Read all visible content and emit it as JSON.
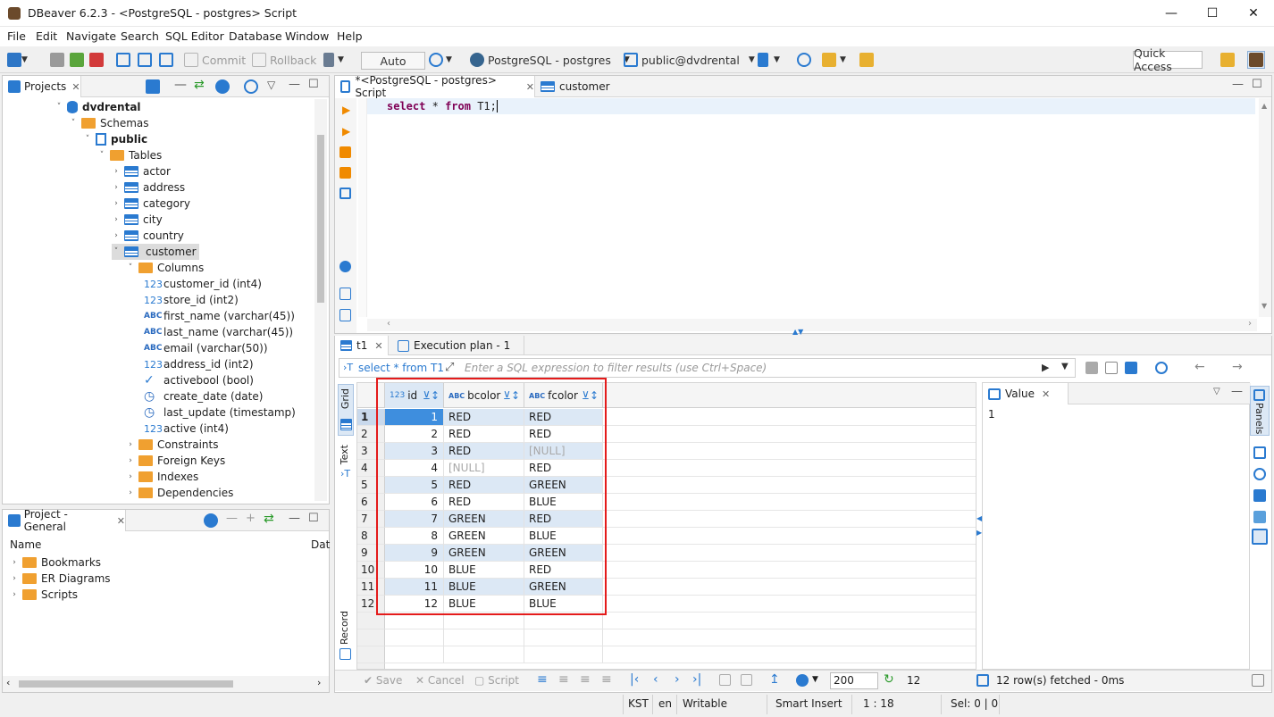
{
  "window": {
    "title": "DBeaver 6.2.3 - <PostgreSQL - postgres> Script"
  },
  "menu": [
    "File",
    "Edit",
    "Navigate",
    "Search",
    "SQL Editor",
    "Database",
    "Window",
    "Help"
  ],
  "toolbar": {
    "commit": "Commit",
    "rollback": "Rollback",
    "mode": "Auto",
    "connection": "PostgreSQL - postgres",
    "schema": "public@dvdrental",
    "quick_access": "Quick Access"
  },
  "projects": {
    "tab": "Projects",
    "tree": [
      {
        "label": "dvdrental",
        "level": 0,
        "icon": "database-icon",
        "bold": true,
        "tw": "v"
      },
      {
        "label": "Schemas",
        "level": 1,
        "icon": "folder-icon",
        "tw": "v"
      },
      {
        "label": "public",
        "level": 2,
        "icon": "schema-icon",
        "bold": true,
        "tw": "v"
      },
      {
        "label": "Tables",
        "level": 3,
        "icon": "folder-icon",
        "tw": "v"
      },
      {
        "label": "actor",
        "level": 4,
        "icon": "table-icon",
        "tw": ">"
      },
      {
        "label": "address",
        "level": 4,
        "icon": "table-icon",
        "tw": ">"
      },
      {
        "label": "category",
        "level": 4,
        "icon": "table-icon",
        "tw": ">"
      },
      {
        "label": "city",
        "level": 4,
        "icon": "table-icon",
        "tw": ">"
      },
      {
        "label": "country",
        "level": 4,
        "icon": "table-icon",
        "tw": ">"
      },
      {
        "label": "customer",
        "level": 4,
        "icon": "table-icon",
        "tw": "v",
        "selected": true
      },
      {
        "label": "Columns",
        "level": 5,
        "icon": "folder-icon",
        "tw": "v"
      },
      {
        "label": "customer_id (int4)",
        "level": 6,
        "icon": "123"
      },
      {
        "label": "store_id (int2)",
        "level": 6,
        "icon": "123"
      },
      {
        "label": "first_name (varchar(45))",
        "level": 6,
        "icon": "ABC"
      },
      {
        "label": "last_name (varchar(45))",
        "level": 6,
        "icon": "ABC"
      },
      {
        "label": "email (varchar(50))",
        "level": 6,
        "icon": "ABC"
      },
      {
        "label": "address_id (int2)",
        "level": 6,
        "icon": "123"
      },
      {
        "label": "activebool (bool)",
        "level": 6,
        "icon": "check"
      },
      {
        "label": "create_date (date)",
        "level": 6,
        "icon": "clock"
      },
      {
        "label": "last_update (timestamp)",
        "level": 6,
        "icon": "clock"
      },
      {
        "label": "active (int4)",
        "level": 6,
        "icon": "123"
      },
      {
        "label": "Constraints",
        "level": 5,
        "icon": "folder-icon",
        "tw": ">"
      },
      {
        "label": "Foreign Keys",
        "level": 5,
        "icon": "folder-icon",
        "tw": ">"
      },
      {
        "label": "Indexes",
        "level": 5,
        "icon": "folder-icon",
        "tw": ">"
      },
      {
        "label": "Dependencies",
        "level": 5,
        "icon": "folder-icon",
        "tw": ">"
      }
    ]
  },
  "project_general": {
    "tab": "Project - General",
    "col_name": "Name",
    "col_date": "Dat",
    "items": [
      "Bookmarks",
      "ER Diagrams",
      "Scripts"
    ]
  },
  "editor": {
    "tab_script": "*<PostgreSQL - postgres> Script",
    "tab_customer": "customer",
    "sql_kw1": "select",
    "sql_star": "*",
    "sql_kw2": "from",
    "sql_rest": "T1;"
  },
  "results": {
    "tab_t1": "t1",
    "tab_plan": "Execution plan - 1",
    "query_label": "select * from T1",
    "filter_placeholder": "Enter a SQL expression to filter results (use Ctrl+Space)",
    "columns": [
      {
        "type": "123",
        "name": "id"
      },
      {
        "type": "ABC",
        "name": "bcolor"
      },
      {
        "type": "ABC",
        "name": "fcolor"
      }
    ],
    "rows": [
      [
        "1",
        "RED",
        "RED"
      ],
      [
        "2",
        "RED",
        "RED"
      ],
      [
        "3",
        "RED",
        "[NULL]"
      ],
      [
        "4",
        "[NULL]",
        "RED"
      ],
      [
        "5",
        "RED",
        "GREEN"
      ],
      [
        "6",
        "RED",
        "BLUE"
      ],
      [
        "7",
        "GREEN",
        "RED"
      ],
      [
        "8",
        "GREEN",
        "BLUE"
      ],
      [
        "9",
        "GREEN",
        "GREEN"
      ],
      [
        "10",
        "BLUE",
        "RED"
      ],
      [
        "11",
        "BLUE",
        "GREEN"
      ],
      [
        "12",
        "BLUE",
        "BLUE"
      ]
    ],
    "side_tabs": {
      "grid": "Grid",
      "text": "Text",
      "record": "Record"
    },
    "value_panel": {
      "title": "Value",
      "content": "1"
    },
    "panels_label": "Panels",
    "bottom": {
      "save": "Save",
      "cancel": "Cancel",
      "script": "Script",
      "fetch_size": "200",
      "count": "12",
      "status": "12 row(s) fetched - 0ms"
    }
  },
  "statusbar": {
    "tz": "KST",
    "lang": "en",
    "mode": "Writable",
    "insert": "Smart Insert",
    "pos": "1 : 18",
    "sel": "Sel: 0 | 0"
  },
  "colors": {
    "highlight": "#e41b1b",
    "selection": "#3e8ede",
    "accent": "#2a7ad0"
  }
}
